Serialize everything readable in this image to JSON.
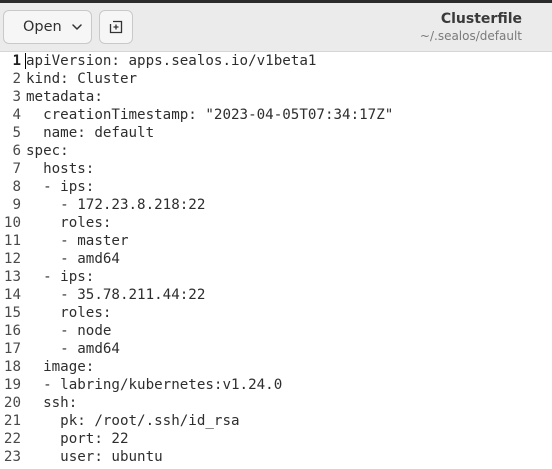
{
  "header": {
    "open_label": "Open",
    "title": "Clusterfile",
    "subtitle": "~/.sealos/default"
  },
  "editor": {
    "current_line": 1,
    "lines": [
      {
        "n": "1",
        "text": "apiVersion: apps.sealos.io/v1beta1"
      },
      {
        "n": "2",
        "text": "kind: Cluster"
      },
      {
        "n": "3",
        "text": "metadata:"
      },
      {
        "n": "4",
        "text": "  creationTimestamp: \"2023-04-05T07:34:17Z\""
      },
      {
        "n": "5",
        "text": "  name: default"
      },
      {
        "n": "6",
        "text": "spec:"
      },
      {
        "n": "7",
        "text": "  hosts:"
      },
      {
        "n": "8",
        "text": "  - ips:"
      },
      {
        "n": "9",
        "text": "    - 172.23.8.218:22"
      },
      {
        "n": "10",
        "text": "    roles:"
      },
      {
        "n": "11",
        "text": "    - master"
      },
      {
        "n": "12",
        "text": "    - amd64"
      },
      {
        "n": "13",
        "text": "  - ips:"
      },
      {
        "n": "14",
        "text": "    - 35.78.211.44:22"
      },
      {
        "n": "15",
        "text": "    roles:"
      },
      {
        "n": "16",
        "text": "    - node"
      },
      {
        "n": "17",
        "text": "    - amd64"
      },
      {
        "n": "18",
        "text": "  image:"
      },
      {
        "n": "19",
        "text": "  - labring/kubernetes:v1.24.0"
      },
      {
        "n": "20",
        "text": "  ssh:"
      },
      {
        "n": "21",
        "text": "    pk: /root/.ssh/id_rsa"
      },
      {
        "n": "22",
        "text": "    port: 22"
      },
      {
        "n": "23",
        "text": "    user: ubuntu"
      }
    ]
  }
}
